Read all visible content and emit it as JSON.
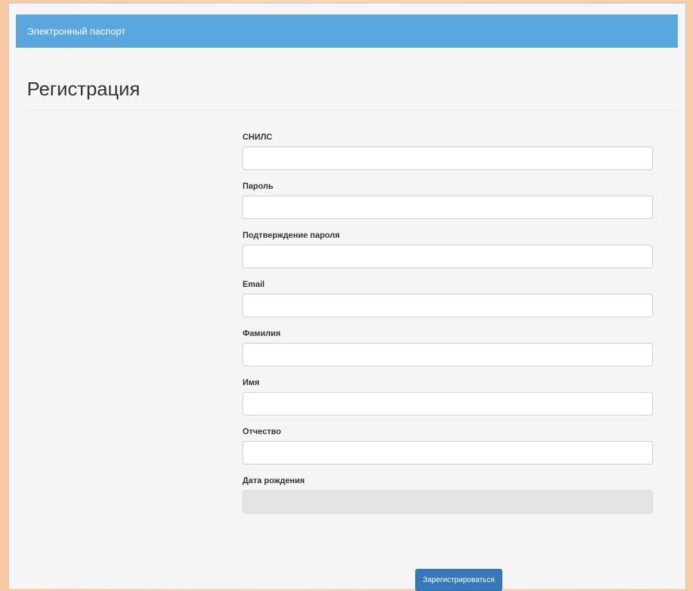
{
  "navbar": {
    "brand": "Электронный паспорт"
  },
  "page": {
    "title": "Регистрация"
  },
  "form": {
    "fields": [
      {
        "label": "СНИЛС",
        "value": "",
        "placeholder": ""
      },
      {
        "label": "Пароль",
        "value": "",
        "placeholder": ""
      },
      {
        "label": "Подтверждение пароля",
        "value": "",
        "placeholder": ""
      },
      {
        "label": "Email",
        "value": "",
        "placeholder": ""
      },
      {
        "label": "Фамилия",
        "value": "",
        "placeholder": ""
      },
      {
        "label": "Имя",
        "value": "",
        "placeholder": ""
      },
      {
        "label": "Отчество",
        "value": "",
        "placeholder": ""
      },
      {
        "label": "Дата рождения",
        "value": "",
        "placeholder": ""
      }
    ],
    "submit_label": "Зарегистрироваться"
  },
  "colors": {
    "navbar": "#5aa7e0",
    "primary_button": "#3679bb",
    "page_background": "#f5f5f5",
    "outer_background": "#f9d6b8"
  }
}
